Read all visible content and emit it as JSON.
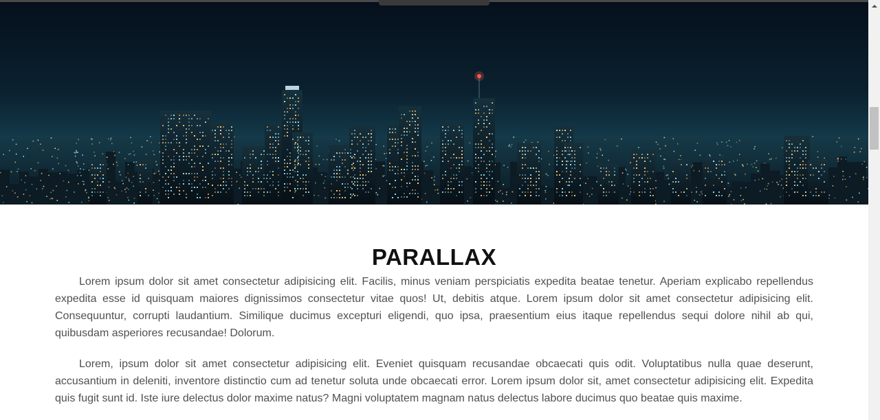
{
  "hero": {
    "image_label": "city-skyline-at-night",
    "colors": {
      "sky_top": "#05101c",
      "sky_mid": "#0e2a3c",
      "horizon": "#1b4b5a",
      "buildings": "#0a1720",
      "lights_warm": "#ffcf7a",
      "lights_cool": "#8fe8ff"
    }
  },
  "article": {
    "title": "PARALLAX",
    "paragraphs": [
      "Lorem ipsum dolor sit amet consectetur adipisicing elit. Facilis, minus veniam perspiciatis expedita beatae tenetur. Aperiam explicabo repellendus expedita esse id quisquam maiores dignissimos consectetur vitae quos! Ut, debitis atque. Lorem ipsum dolor sit amet consectetur adipisicing elit. Consequuntur, corrupti laudantium. Similique ducimus excepturi eligendi, quo ipsa, praesentium eius itaque repellendus sequi dolore nihil ab qui, quibusdam asperiores recusandae! Dolorum.",
      "Lorem, ipsum dolor sit amet consectetur adipisicing elit. Eveniet quisquam recusandae obcaecati quis odit. Voluptatibus nulla quae deserunt, accusantium in deleniti, inventore distinctio cum ad tenetur soluta unde obcaecati error. Lorem ipsum dolor sit, amet consectetur adipisicing elit. Expedita quis fugit sunt id. Iste iure delectus dolor maxime natus? Magni voluptatem magnam natus delectus labore ducimus quo beatae quis maxime."
    ]
  },
  "scrollbar": {
    "scroll_fraction": 0.27
  }
}
